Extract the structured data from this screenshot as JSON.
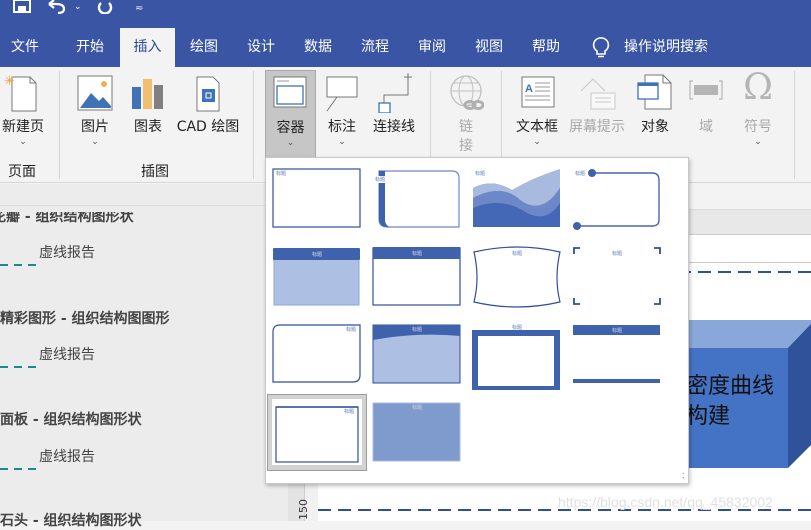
{
  "quick_access": {
    "icons": [
      "save-icon",
      "undo-icon",
      "redo-icon",
      "customize-icon"
    ]
  },
  "tabs": [
    {
      "label": "文件",
      "active": false
    },
    {
      "label": "开始",
      "active": false
    },
    {
      "label": "插入",
      "active": true
    },
    {
      "label": "绘图",
      "active": false
    },
    {
      "label": "设计",
      "active": false
    },
    {
      "label": "数据",
      "active": false
    },
    {
      "label": "流程",
      "active": false
    },
    {
      "label": "审阅",
      "active": false
    },
    {
      "label": "视图",
      "active": false
    },
    {
      "label": "帮助",
      "active": false
    }
  ],
  "tell_me": "操作说明搜索",
  "ribbon": {
    "buttons": {
      "new_page": "新建页",
      "picture": "图片",
      "chart": "图表",
      "cad": "CAD 绘图",
      "container": "容器",
      "callout": "标注",
      "connector": "连接线",
      "link_1": "链",
      "link_2": "接",
      "textbox": "文本框",
      "screentip": "屏幕提示",
      "object": "对象",
      "field": "域",
      "symbol": "符号"
    },
    "groups": {
      "pages": "页面",
      "illustrations": "插图"
    }
  },
  "container_gallery": {
    "item_title": "标题",
    "selected_index": 12,
    "count": 14
  },
  "shapes_pane": {
    "items": [
      {
        "title": "花瓣 - 组织结构图形状",
        "shape": "虚线报告"
      },
      {
        "title": "精彩图形 - 组织结构图图形",
        "shape": "虚线报告"
      },
      {
        "title": "面板 - 组织结构图形状",
        "shape": "虚线报告"
      },
      {
        "title": "石头 - 组织结构图形状",
        "shape": ""
      }
    ]
  },
  "canvas": {
    "box_text_line1": "密度曲线",
    "box_text_line2": "构建",
    "ruler_label": "150",
    "watermark": "https://blog.csdn.net/qq_45832002"
  },
  "colors": {
    "accent": "#3955a3",
    "container_blue": "#3f62ad",
    "container_light": "#adc0e3"
  }
}
